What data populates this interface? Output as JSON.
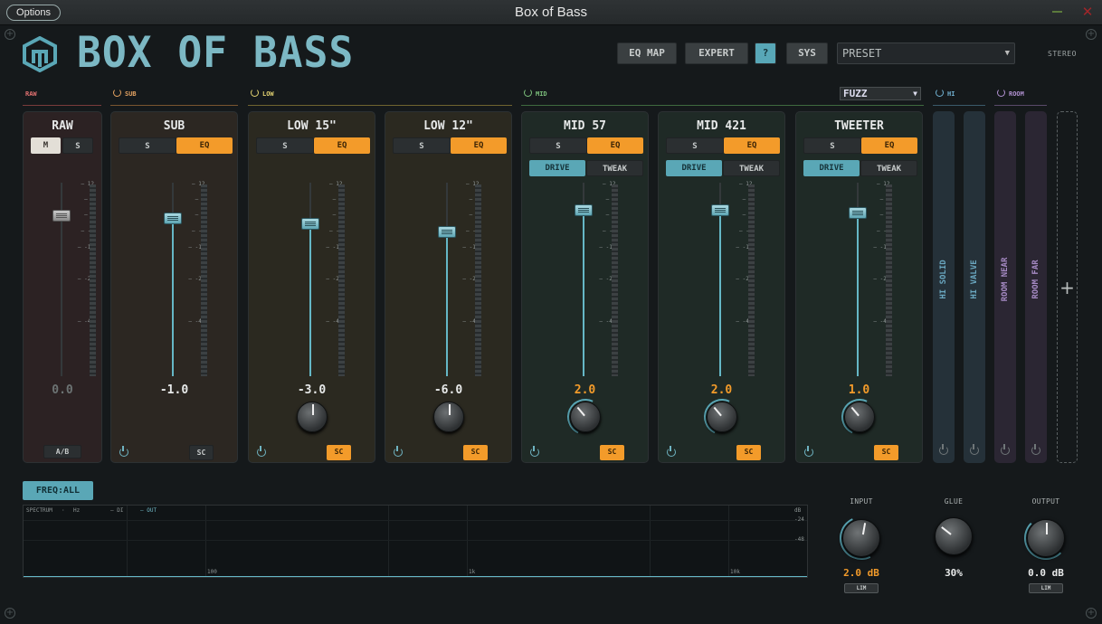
{
  "window": {
    "title": "Box of Bass",
    "options_label": "Options",
    "minimize_glyph": "—",
    "close_glyph": "✕"
  },
  "header": {
    "logo_text": "BOX OF BASS",
    "buttons": {
      "eq_map": "EQ MAP",
      "expert": "EXPERT",
      "help": "?",
      "sys": "SYS"
    },
    "preset": "PRESET",
    "stereo": "STEREO"
  },
  "groups": {
    "raw": {
      "label": "RAW",
      "color": "#e07070"
    },
    "sub": {
      "label": "SUB",
      "color": "#e0a060"
    },
    "low": {
      "label": "LOW",
      "color": "#e0d070"
    },
    "mid": {
      "label": "MID",
      "color": "#7cc07c"
    },
    "hi": {
      "label": "HI",
      "color": "#70b0d0"
    },
    "room": {
      "label": "ROOM",
      "color": "#b090d0"
    }
  },
  "mid_mode": "FUZZ",
  "scale_ticks": [
    "12",
    "6",
    "0",
    "-6",
    "-12",
    "-24",
    "-48"
  ],
  "channels": [
    {
      "name": "RAW",
      "btn_left": "M",
      "btn_right": "S",
      "value": "0.0",
      "level_db": 0,
      "footer": "A/B"
    },
    {
      "name": "SUB",
      "btn_left": "S",
      "btn_right": "EQ",
      "value": "-1.0",
      "level_db": -1,
      "sc": "SC"
    },
    {
      "name": "LOW 15\"",
      "btn_left": "S",
      "btn_right": "EQ",
      "value": "-3.0",
      "level_db": -3,
      "sc": "SC"
    },
    {
      "name": "LOW 12\"",
      "btn_left": "S",
      "btn_right": "EQ",
      "value": "-6.0",
      "level_db": -6,
      "sc": "SC"
    },
    {
      "name": "MID 57",
      "btn_left": "S",
      "btn_right": "EQ",
      "drive": "DRIVE",
      "tweak": "TWEAK",
      "value": "2.0",
      "level_db": 2,
      "sc": "SC"
    },
    {
      "name": "MID 421",
      "btn_left": "S",
      "btn_right": "EQ",
      "drive": "DRIVE",
      "tweak": "TWEAK",
      "value": "2.0",
      "level_db": 2,
      "sc": "SC"
    },
    {
      "name": "TWEETER",
      "btn_left": "S",
      "btn_right": "EQ",
      "drive": "DRIVE",
      "tweak": "TWEAK",
      "value": "1.0",
      "level_db": 1,
      "sc": "SC"
    }
  ],
  "side_strips": [
    {
      "label": "HI SOLID",
      "color": "#6aa7c0"
    },
    {
      "label": "HI VALVE",
      "color": "#6aa7c0"
    },
    {
      "label": "ROOM NEAR",
      "color": "#a68ac4"
    },
    {
      "label": "ROOM FAR",
      "color": "#a68ac4"
    }
  ],
  "add_strip": "+",
  "spectrum": {
    "freq_button": "FREQ:ALL",
    "spectrum_label": "SPECTRUM",
    "hz_label": "Hz",
    "di_label": "— DI",
    "out_label": "— OUT",
    "db_labels": [
      "dB",
      "-24",
      "-48"
    ],
    "freq_labels": [
      "100",
      "1k",
      "10k"
    ]
  },
  "master": {
    "input": {
      "label": "INPUT",
      "value": "2.0 dB",
      "lim": "LIM"
    },
    "glue": {
      "label": "GLUE",
      "value": "30%"
    },
    "output": {
      "label": "OUTPUT",
      "value": "0.0 dB",
      "lim": "LIM"
    }
  }
}
